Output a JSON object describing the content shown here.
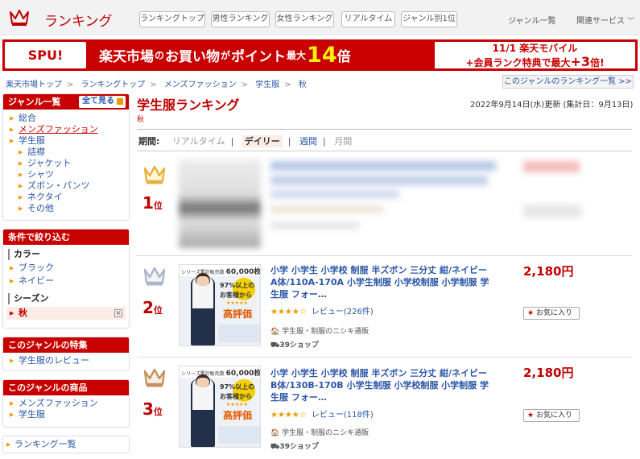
{
  "header": {
    "logo_text": "ランキング",
    "tabs": [
      "ランキングトップ",
      "男性ランキング",
      "女性ランキング",
      "リアルタイム",
      "ジャンル別1位"
    ],
    "genre_list": "ジャンル一覧",
    "related_services": "関連サービス"
  },
  "banner": {
    "spu_label": "SPU!",
    "main_text_1": "楽天市場",
    "main_text_2": "の",
    "main_text_3": "お買い物",
    "main_text_4": "が",
    "main_text_5": "ポイント",
    "main_text_6": "最大",
    "main_big_num": "14",
    "main_suffix": "倍",
    "right_line1_date": "11/1",
    "right_line1_text": "楽天モバイル",
    "right_line2_prefix": "+会員ランク特典で最大",
    "right_line2_num": "+3",
    "right_line2_suffix": "倍!"
  },
  "breadcrumb": [
    "楽天市場トップ",
    "ランキングトップ",
    "メンズファッション",
    "学生服",
    "秋"
  ],
  "genre_ranking_link": "このジャンルのランキング一覧 >>",
  "sidebar": {
    "genre_title": "ジャンル一覧",
    "see_all": "全て見る",
    "genre_items": [
      {
        "label": "総合",
        "level": 0,
        "style": "normal"
      },
      {
        "label": "メンズファッション",
        "level": 0,
        "style": "underline"
      },
      {
        "label": "学生服",
        "level": 0,
        "style": "normal"
      },
      {
        "label": "詰襟",
        "level": 1,
        "style": "normal"
      },
      {
        "label": "ジャケット",
        "level": 1,
        "style": "normal"
      },
      {
        "label": "シャツ",
        "level": 1,
        "style": "normal"
      },
      {
        "label": "ズボン・パンツ",
        "level": 1,
        "style": "normal"
      },
      {
        "label": "ネクタイ",
        "level": 1,
        "style": "normal"
      },
      {
        "label": "その他",
        "level": 1,
        "style": "normal"
      }
    ],
    "filter_title": "条件で絞り込む",
    "color_label": "カラー",
    "colors": [
      "ブラック",
      "ネイビー"
    ],
    "season_label": "シーズン",
    "season_selected": "秋",
    "feature_title": "このジャンルの特集",
    "feature_items": [
      "学生服のレビュー"
    ],
    "product_title": "このジャンルの商品",
    "product_items": [
      "メンズファッション",
      "学生服"
    ],
    "ranking_list": "ランキング一覧"
  },
  "main": {
    "title": "学生服ランキング",
    "subtitle": "秋",
    "updated": "2022年9月14日(水)更新 (集計日：9月13日)",
    "period_label": "期間:",
    "periods": [
      "リアルタイム",
      "デイリー",
      "週間",
      "月間"
    ],
    "active_period": "デイリー"
  },
  "rankings": [
    {
      "rank": "1",
      "rank_suffix": "位",
      "crown": "gold-crown-icon",
      "blurred": true
    },
    {
      "rank": "2",
      "rank_suffix": "位",
      "crown": "silver-crown-icon",
      "title": "小学 小学生 小学校 制服 半ズボン 三分丈 紺/ネイビー A体/110A-170A 小学生制服 小学校制服 小学制服 学生服 フォー…",
      "stars": "★★★★☆",
      "reviews": "レビュー(226件)",
      "shop": "学生服・制服のニシキ通販",
      "shipping": "39ショップ",
      "price": "2,180円",
      "fav": "お気に入り",
      "img_badge": "60,000枚突破",
      "img_badge_small": "シリーズ累計販売数",
      "img_pct": "97%以上の",
      "img_customer": "お客様から",
      "img_eval": "高評価"
    },
    {
      "rank": "3",
      "rank_suffix": "位",
      "crown": "bronze-crown-icon",
      "title": "小学 小学生 小学校 制服 半ズボン 三分丈 紺/ネイビー B体/130B-170B 小学生制服 小学校制服 小学制服 学生服 フォー…",
      "stars": "★★★★☆",
      "reviews": "レビュー(118件)",
      "shop": "学生服・制服のニシキ通販",
      "shipping": "39ショップ",
      "price": "2,180円",
      "fav": "お気に入り",
      "img_badge": "60,000枚突破",
      "img_badge_small": "シリーズ累計販売数",
      "img_pct": "97%以上の",
      "img_customer": "お客様から",
      "img_eval": "高評価"
    }
  ],
  "colors": {
    "brand": "#bf0000",
    "link": "#2a55a8",
    "accent": "#f39800",
    "gold": "#e8b23a",
    "silver": "#aab6c8",
    "bronze": "#c6915f"
  }
}
